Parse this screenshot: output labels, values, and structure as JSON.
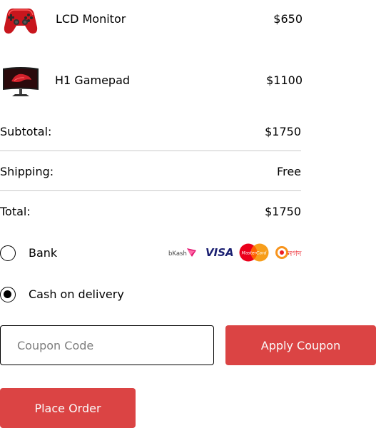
{
  "products": [
    {
      "name": "LCD Monitor",
      "price": "$650",
      "thumbnail_icon": "red-gamepad-image"
    },
    {
      "name": "H1 Gamepad",
      "price": "$1100",
      "thumbnail_icon": "monitor-image"
    }
  ],
  "summary": {
    "subtotal_label": "Subtotal:",
    "subtotal_value": "$1750",
    "shipping_label": "Shipping:",
    "shipping_value": "Free",
    "total_label": "Total:",
    "total_value": "$1750"
  },
  "payment": {
    "options": [
      {
        "label": "Bank",
        "selected": false
      },
      {
        "label": "Cash on delivery",
        "selected": true
      }
    ],
    "logos": {
      "bkash_text": "bKash",
      "visa_text": "VISA",
      "mastercard_text": "MasterCard",
      "nagad_text": "নগদ"
    }
  },
  "coupon": {
    "placeholder": "Coupon Code",
    "value": "",
    "apply_label": "Apply Coupon"
  },
  "place_order_label": "Place Order",
  "colors": {
    "accent": "#db4444",
    "button_text": "#fafafa",
    "divider": "#c8c8c8",
    "visa_blue": "#1a1f71",
    "mastercard_red": "#eb001b",
    "mastercard_orange": "#f79e1b",
    "bkash_pink": "#e2136e",
    "nagad_orange": "#f7941d"
  }
}
